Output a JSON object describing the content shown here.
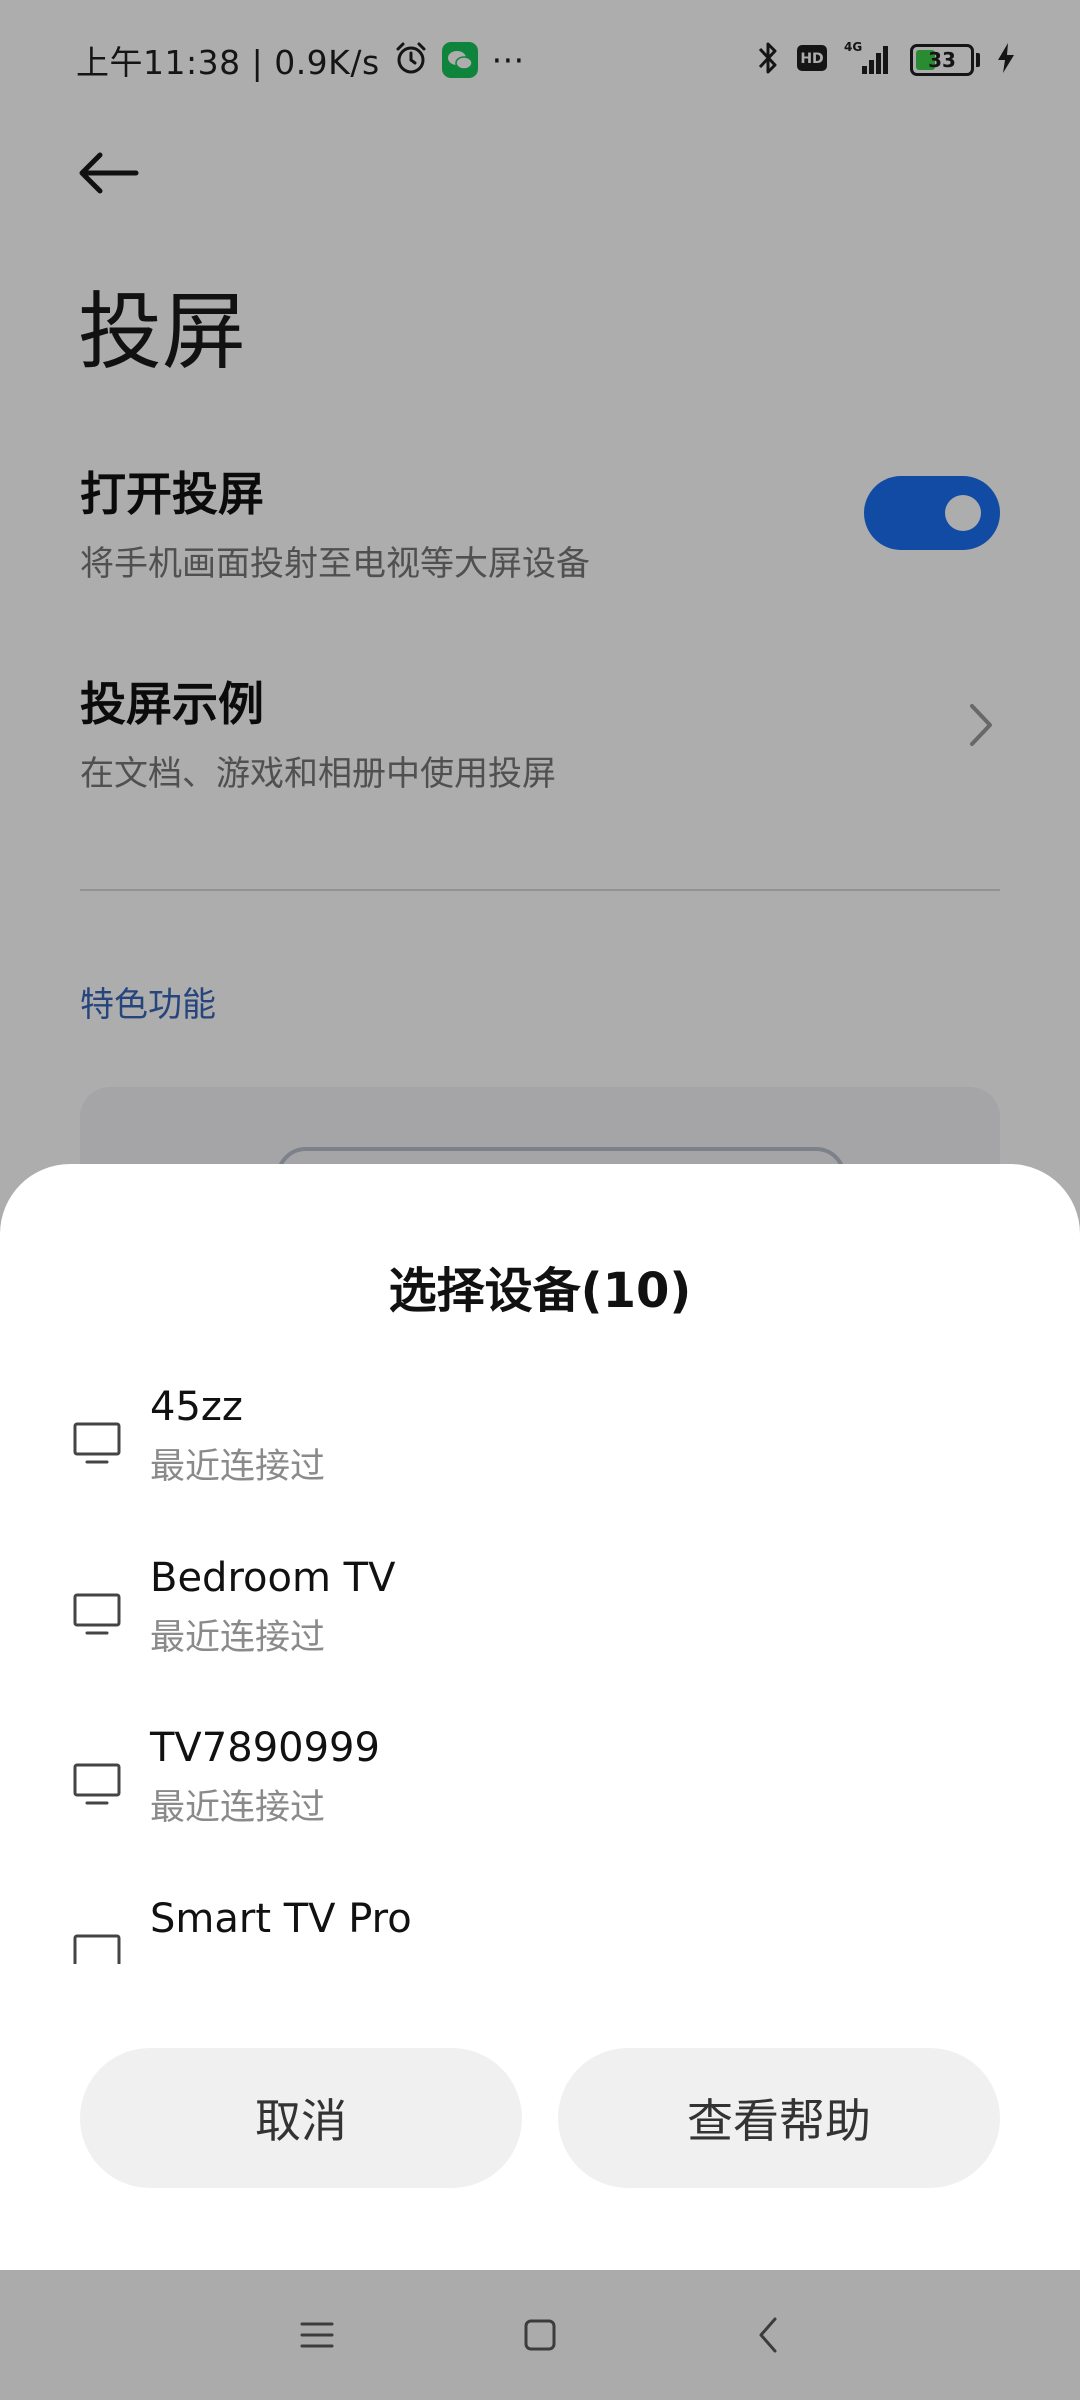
{
  "status_bar": {
    "time_and_speed": "上午11:38 | 0.9K/s",
    "more_glyph": "···",
    "battery_level": "33",
    "battery_fraction": 0.33,
    "network_label": "4G",
    "hd_label": "HD",
    "icons": [
      "alarm-icon",
      "wechat-icon",
      "bluetooth-icon",
      "hd-icon",
      "signal-icon",
      "battery-icon",
      "charging-icon"
    ]
  },
  "page": {
    "back_icon": "back-arrow-icon",
    "title": "投屏",
    "cast_toggle": {
      "title": "打开投屏",
      "subtitle": "将手机画面投射至电视等大屏设备",
      "enabled": true
    },
    "examples": {
      "title": "投屏示例",
      "subtitle": "在文档、游戏和相册中使用投屏"
    },
    "section_label": "特色功能"
  },
  "sheet": {
    "title": "选择设备(10)",
    "devices": [
      {
        "name": "45zz",
        "status": "最近连接过"
      },
      {
        "name": "Bedroom TV",
        "status": "最近连接过"
      },
      {
        "name": "TV7890999",
        "status": "最近连接过"
      },
      {
        "name": "Smart TV Pro",
        "status": ""
      }
    ],
    "cancel_label": "取消",
    "help_label": "查看帮助"
  },
  "colors": {
    "accent": "#1b6ff0",
    "section_label": "#3a66b8",
    "wechat": "#17c35a",
    "battery": "#3fcf4a"
  }
}
